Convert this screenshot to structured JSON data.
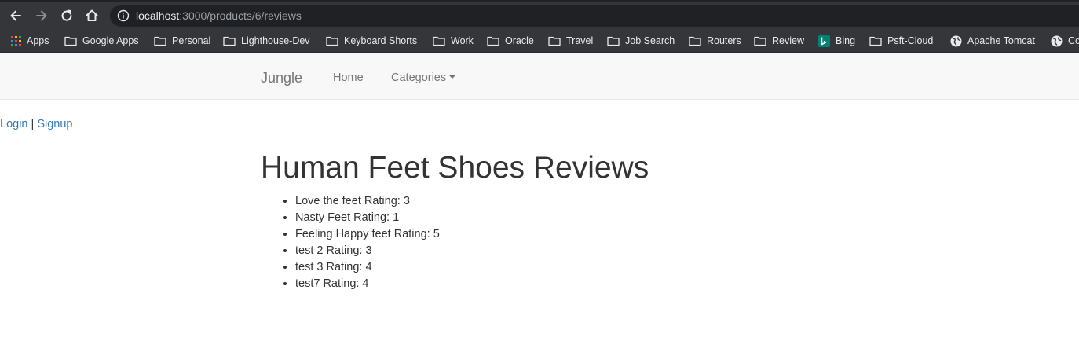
{
  "browser": {
    "url_host": "localhost",
    "url_path": ":3000/products/6/reviews",
    "bookmarks": [
      {
        "label": "Apps",
        "icon": "apps-grid-icon"
      },
      {
        "label": "Google Apps",
        "icon": "folder-icon"
      },
      {
        "label": "Personal",
        "icon": "folder-icon"
      },
      {
        "label": "Lighthouse-Dev",
        "icon": "folder-icon"
      },
      {
        "label": "Keyboard Shorts",
        "icon": "folder-icon"
      },
      {
        "label": "Work",
        "icon": "folder-icon"
      },
      {
        "label": "Oracle",
        "icon": "folder-icon"
      },
      {
        "label": "Travel",
        "icon": "folder-icon"
      },
      {
        "label": "Job Search",
        "icon": "folder-icon"
      },
      {
        "label": "Routers",
        "icon": "folder-icon"
      },
      {
        "label": "Review",
        "icon": "folder-icon"
      },
      {
        "label": "Bing",
        "icon": "bing-icon"
      },
      {
        "label": "Psft-Cloud",
        "icon": "folder-icon"
      },
      {
        "label": "Apache Tomcat",
        "icon": "globe-icon"
      },
      {
        "label": "Co",
        "icon": "globe-icon"
      }
    ]
  },
  "navbar": {
    "brand": "Jungle",
    "home": "Home",
    "categories": "Categories"
  },
  "auth": {
    "login": "Login",
    "separator": "|",
    "signup": "Signup"
  },
  "page": {
    "title": "Human Feet Shoes Reviews",
    "reviews": [
      "Love the feet Rating: 3",
      "Nasty Feet Rating: 1",
      "Feeling Happy feet Rating: 5",
      "test 2 Rating: 3",
      "test 3 Rating: 4",
      "test7 Rating: 4"
    ]
  }
}
